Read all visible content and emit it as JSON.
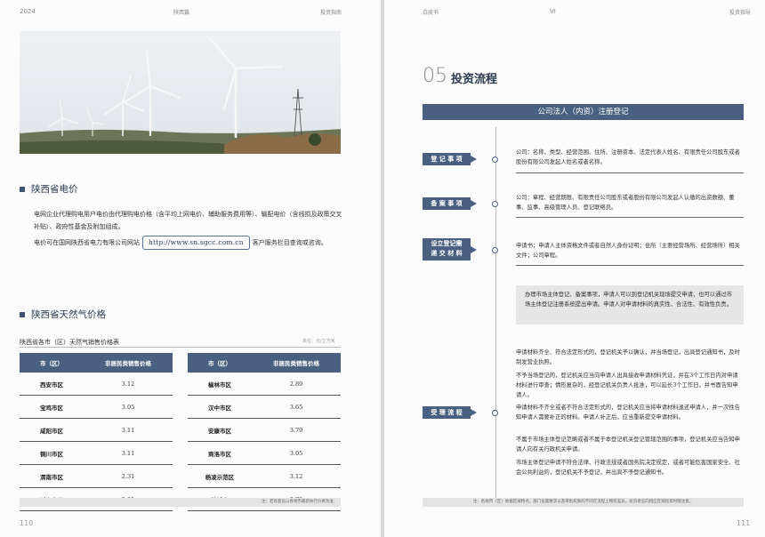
{
  "left_page": {
    "header_year": "2024",
    "header_mid": "陕西篇",
    "header_right": "投资指南",
    "page_number": "110",
    "electricity": {
      "title": "陕西省电价",
      "para1": "电网企业代理购电用户电价由代理购电价格（含平均上网电价、辅助服务费用等）、输配电价（含线损及政策交叉补贴）、政府性基金及附加组成。",
      "para2_before": "电价可在国网陕西省电力有限公司网站",
      "url": "http://www.sn.sgcc.com.cn",
      "para2_after": "客户服务栏目查询或咨询。"
    },
    "gas": {
      "title": "陕西省天然气价格",
      "table_caption": "陕西省各市（区）天然气销售价格表",
      "unit": "单位：元/立方米",
      "col_city": "市（区）",
      "col_price": "非居民类销售价格",
      "left_rows": [
        {
          "city": "西安市区",
          "price": "3.12"
        },
        {
          "city": "宝鸡市区",
          "price": "3.05"
        },
        {
          "city": "咸阳市区",
          "price": "3.11"
        },
        {
          "city": "铜川市区",
          "price": "3.11"
        },
        {
          "city": "渭南市区",
          "price": "2.31"
        },
        {
          "city": "延安市区",
          "price": "2.81"
        }
      ],
      "right_rows": [
        {
          "city": "榆林市区",
          "price": "2.89"
        },
        {
          "city": "汉中市区",
          "price": "3.65"
        },
        {
          "city": "安康市区",
          "price": "3.79"
        },
        {
          "city": "商洛市区",
          "price": "3.05"
        },
        {
          "city": "杨凌示范区",
          "price": "3.12"
        },
        {
          "city": "韩城市",
          "price": "2.79"
        }
      ],
      "note": "注：若有变化以各地市最新执行价格为准"
    }
  },
  "right_page": {
    "header_left": "白皮书",
    "header_mid": "VI",
    "header_right": "投资指导",
    "page_number": "111",
    "section_number": "05",
    "section_title": "投资流程",
    "banner": "公司法人（内资）注册登记",
    "steps": [
      {
        "label": "登 记 事 项",
        "desc": "公司：名称、类型、经营范围、住所、注册资本、法定代表人姓名、有限责任公司股东或者股份有限公司发起人姓名或者名称。"
      },
      {
        "label": "备 案 事 项",
        "desc": "公司：章程、经营期限、有限责任公司股东或者股份有限公司发起人认缴的出资数额、董事、监事、高级管理人员、登记联络员。"
      },
      {
        "label": "设立登记需\n递 交 材 料",
        "desc": "申请书；申请人主体资格文件或者自然人身份证明；住所（主要经营场所、经营场所）相关文件；公司章程。"
      },
      {
        "label": "受 理 流 程",
        "desc": ""
      }
    ],
    "gray_note": "办理市场主体登记、备案事项，申请人可以到登记机关现场提交申请，也可以通过市场主体登记注册系统提出申请。申请人对申请材料的真实性、合法性、有效性负责。",
    "accept_paras": [
      "申请材料齐全、符合法定形式的，登记机关予以确认，并当场登记，出具登记通知书，及时制发营业执照。",
      "不予当场登记的，登记机关应当向申请人出具接收申请材料凭证，并在3个工作日内对申请材料进行审查；情形复杂的，经登记机关负责人批准，可以延长3个工作日，并书面告知申请人。",
      "申请材料不齐全或者不符合法定形式的，登记机关应当将申请材料退还申请人，并一次性告知申请人需要补正的材料。申请人补正后，应当重新提交申请材料。",
      "不属于市场主体登记范畴或者不属于本登记机关登记管辖范围的事项，登记机关应当告知申请人向有关行政机关申请。",
      "市场主体登记申请不符合法律、行政法规或者国务院决定规定，或者可能危害国家安全、社会公共利益的，登记机关不予登记，并出具不予登记通知书。"
    ],
    "note": "注：各地市（区）依据区域特点，部门设置要求以及审批权限的不同在流程上略有差异，投资者应向相应区域投资时限注意。"
  }
}
